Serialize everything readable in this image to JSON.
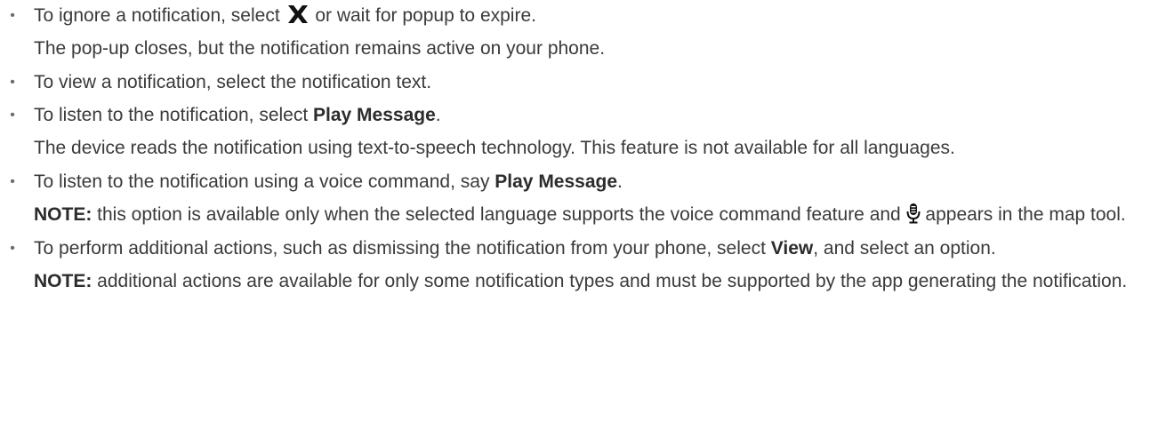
{
  "items": [
    {
      "text_before": "To ignore a notification, select ",
      "icon": "close-x-icon",
      "text_after": " or wait for popup to expire.",
      "sub": "The pop-up closes, but the notification remains active on your phone."
    },
    {
      "text": "To view a notification, select the notification text."
    },
    {
      "text_before": "To listen to the notification, select ",
      "bold": "Play Message",
      "text_after": ".",
      "sub": "The device reads the notification using text-to-speech technology. This feature is not available for all languages."
    },
    {
      "text_before": "To listen to the notification using a voice command, say ",
      "bold": "Play Message",
      "text_after": ".",
      "note_label": "NOTE:",
      "note_text_before": " this option is available only when the selected language supports the voice command feature and ",
      "note_icon": "microphone-icon",
      "note_text_after": " appears in the map tool."
    },
    {
      "text_before": "To perform additional actions, such as dismissing the notification from your phone, select ",
      "bold": "View",
      "text_after": ", and select an option.",
      "note_label": "NOTE:",
      "note_text": " additional actions are available for only some notification types and must be supported by the app generating the notification."
    }
  ],
  "bullet_char": "•"
}
